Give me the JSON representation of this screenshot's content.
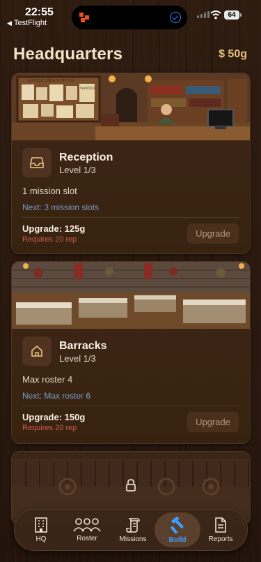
{
  "status_bar": {
    "time": "22:55",
    "back_app": "TestFlight",
    "battery": "64"
  },
  "header": {
    "title": "Headquarters",
    "gold": "$ 50g"
  },
  "buildings": [
    {
      "name": "Reception",
      "level": "Level 1/3",
      "effect": "1 mission slot",
      "next": "Next: 3 mission slots",
      "cost": "Upgrade: 125g",
      "requirement": "Requires 20 rep",
      "button": "Upgrade",
      "icon": "inbox-icon",
      "art_sign": "ADVENTURER NOTICES",
      "art_wanted": "WANTED"
    },
    {
      "name": "Barracks",
      "level": "Level 1/3",
      "effect": "Max roster 4",
      "next": "Next: Max roster 6",
      "cost": "Upgrade: 150g",
      "requirement": "Requires 20 rep",
      "button": "Upgrade",
      "icon": "house-icon"
    },
    {
      "locked": true,
      "icon": "lock-icon"
    }
  ],
  "tabs": [
    {
      "label": "HQ",
      "icon": "building-icon",
      "active": false
    },
    {
      "label": "Roster",
      "icon": "people-icon",
      "active": false
    },
    {
      "label": "Missions",
      "icon": "scroll-icon",
      "active": false
    },
    {
      "label": "Build",
      "icon": "hammer-icon",
      "active": true
    },
    {
      "label": "Reports",
      "icon": "document-icon",
      "active": false
    }
  ],
  "colors": {
    "background": "#2a190f",
    "card": "#3c2415",
    "title": "#f4e3c6",
    "gold": "#e7c27b",
    "next_text": "#7c99c4",
    "requirement": "#cf5b52",
    "active_tab": "#3ea0ff"
  }
}
